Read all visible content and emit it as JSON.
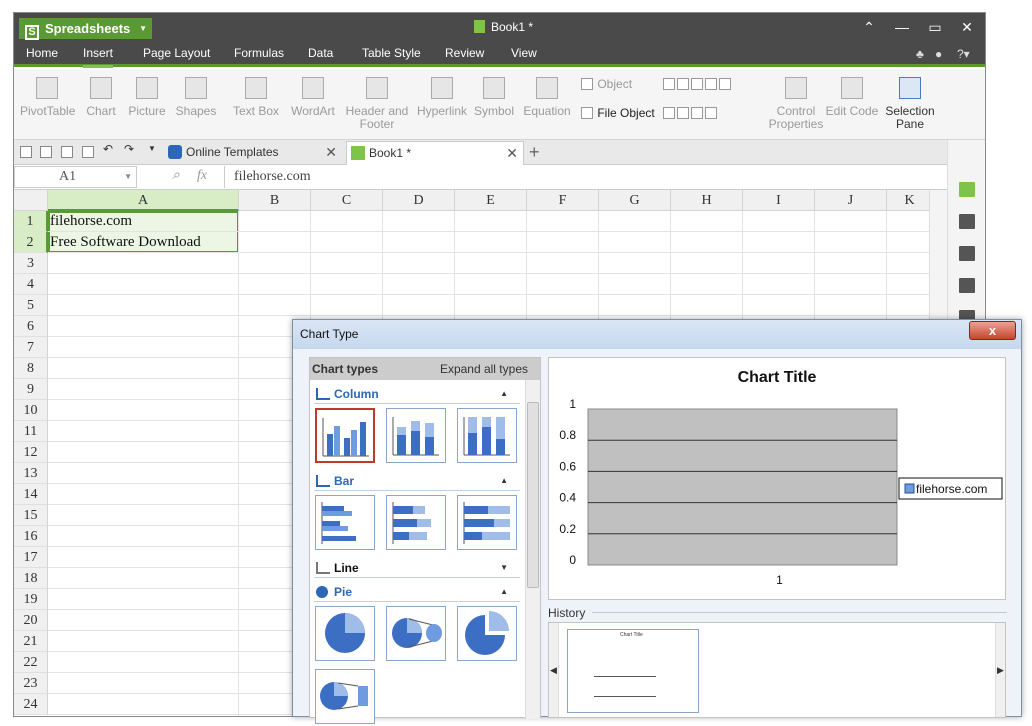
{
  "app": {
    "name": "Spreadsheets",
    "doc_title": "Book1 *"
  },
  "menu": [
    "Home",
    "Insert",
    "Page Layout",
    "Formulas",
    "Data",
    "Table Style",
    "Review",
    "View"
  ],
  "ribbon": {
    "pivottable": "PivotTable",
    "chart": "Chart",
    "picture": "Picture",
    "shapes": "Shapes",
    "textbox": "Text Box",
    "wordart": "WordArt",
    "header_footer_1": "Header and",
    "header_footer_2": "Footer",
    "hyperlink": "Hyperlink",
    "symbol": "Symbol",
    "equation": "Equation",
    "object": "Object",
    "file_object": "File Object",
    "control_props_1": "Control",
    "control_props_2": "Properties",
    "edit_code": "Edit Code",
    "selection_pane_1": "Selection",
    "selection_pane_2": "Pane"
  },
  "tabs": {
    "online_templates": "Online Templates",
    "book1": "Book1 *"
  },
  "formula": {
    "name_box": "A1",
    "fx": "fx",
    "value": "filehorse.com"
  },
  "grid": {
    "columns": [
      "A",
      "B",
      "C",
      "D",
      "E",
      "F",
      "G",
      "H",
      "I",
      "J",
      "K"
    ],
    "rows": [
      "1",
      "2",
      "3",
      "4",
      "5",
      "6",
      "7",
      "8",
      "9",
      "10",
      "11",
      "12",
      "13",
      "14",
      "15",
      "16",
      "17",
      "18",
      "19",
      "20",
      "21",
      "22",
      "23",
      "24"
    ],
    "a1": "filehorse.com",
    "a2": "Free Software Download"
  },
  "dialog": {
    "title": "Chart Type",
    "close": "x",
    "chart_types_label": "Chart types",
    "expand_all": "Expand all types",
    "sections": {
      "column": "Column",
      "bar": "Bar",
      "line": "Line",
      "pie": "Pie"
    },
    "history_label": "History",
    "mini_title": "Chart Title"
  },
  "chart_data": {
    "type": "bar",
    "title": "Chart Title",
    "categories": [
      "1"
    ],
    "series": [
      {
        "name": "filehorse.com",
        "values": [
          0
        ]
      }
    ],
    "ylim": [
      0,
      1
    ],
    "yticks": [
      "1",
      "0.8",
      "0.6",
      "0.4",
      "0.2",
      "0"
    ],
    "grid": true,
    "legend": "right",
    "plot_bg": "#c0c0c0"
  },
  "colors": {
    "accent": "#5a9a32",
    "titlebar": "#4a4a4a",
    "chart_blue": "#2b67b5"
  }
}
